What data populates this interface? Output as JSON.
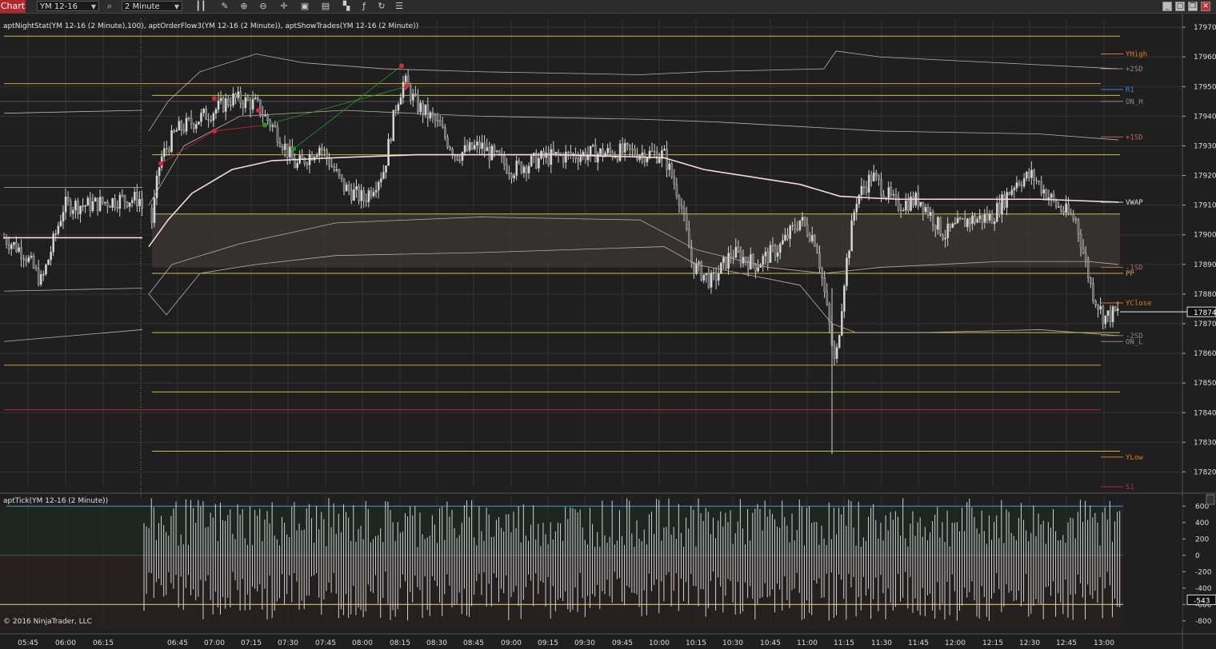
{
  "toolbar": {
    "tab": "Chart",
    "instrument": "YM 12-16",
    "interval": "2 Minute",
    "icons": [
      "bar-style-icon",
      "pencil-icon",
      "zoom-in-icon",
      "zoom-out-icon",
      "crosshair-icon",
      "data-box-icon",
      "strategy-icon",
      "indicators-icon",
      "refresh-icon",
      "properties-icon"
    ],
    "window_buttons": [
      "minimize",
      "tile",
      "restore",
      "close"
    ]
  },
  "indicator_label": "aptNightStat(YM 12-16 (2 Minute),100), aptOrderFlow3(YM 12-16 (2 Minute)), aptShowTrades(YM 12-16 (2 Minute))",
  "sub_label": "aptTick(YM 12-16 (2 Minute))",
  "copyright": "© 2016 NinjaTrader, LLC",
  "colors": {
    "bg": "#1f1f1f",
    "grid": "#333333",
    "yellow_line": "#c8c13a",
    "orange_line": "#d39a3a",
    "red_line": "#c0273a",
    "vwap": "#f4d9e2",
    "band": "#c4a8ae",
    "candle": "#e0e0e0"
  },
  "chart_data": {
    "type": "candlestick",
    "instrument": "YM 12-16",
    "timeframe": "2 Minute",
    "x_tick_labels": [
      "05:45",
      "06:00",
      "06:15",
      "06:45",
      "07:00",
      "07:15",
      "07:30",
      "07:45",
      "08:00",
      "08:15",
      "08:30",
      "08:45",
      "09:00",
      "09:15",
      "09:30",
      "09:45",
      "10:00",
      "10:15",
      "10:30",
      "10:45",
      "11:00",
      "11:15",
      "11:30",
      "11:45",
      "12:00",
      "12:15",
      "12:30",
      "12:45",
      "13:00"
    ],
    "y_tick_labels": [
      "17970",
      "17960",
      "17950",
      "17940",
      "17930",
      "17920",
      "17910",
      "17900",
      "17890",
      "17880",
      "17870",
      "17860",
      "17850",
      "17840",
      "17830",
      "17820"
    ],
    "ylim": [
      17815,
      17973
    ],
    "last_price": "17874",
    "levels": [
      {
        "label": "YHigh",
        "value": 17961,
        "color": "#e07a1a"
      },
      {
        "label": "+2SD",
        "value": 17956,
        "color": "#a07e84"
      },
      {
        "label": "R1",
        "value": 17949,
        "color": "#3b82d6"
      },
      {
        "label": "ON_H",
        "value": 17945,
        "color": "#8a8a8a"
      },
      {
        "label": "+1SD",
        "value": 17933,
        "color": "#b8645a"
      },
      {
        "label": "VWAP",
        "value": 17911,
        "color": "#e8d5dc"
      },
      {
        "label": "-1SD",
        "value": 17889,
        "color": "#b8645a"
      },
      {
        "label": "PP",
        "value": 17887,
        "color": "#d8a23a"
      },
      {
        "label": "YClose",
        "value": 17877,
        "color": "#e07a1a"
      },
      {
        "label": "-2SD",
        "value": 17866,
        "color": "#a07e84"
      },
      {
        "label": "ON_L",
        "value": 17864,
        "color": "#8a8a8a"
      },
      {
        "label": "YLow",
        "value": 17825,
        "color": "#e07a1a"
      },
      {
        "label": "S1",
        "value": 17815,
        "color": "#c0273a"
      }
    ],
    "subchart": {
      "name": "aptTick",
      "y_tick_labels": [
        "600",
        "400",
        "200",
        "0",
        "-200",
        "-400",
        "-600",
        "-800"
      ],
      "ylim": [
        -900,
        720
      ],
      "last_value": "-543",
      "upper_band": 600,
      "lower_band": -600
    }
  }
}
